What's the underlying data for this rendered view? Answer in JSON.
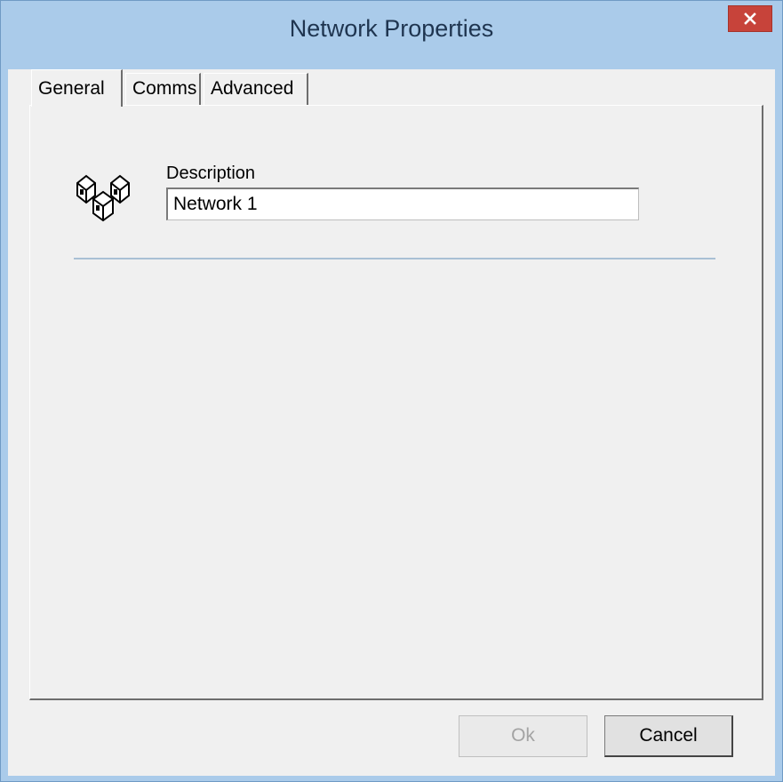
{
  "window": {
    "title": "Network Properties",
    "close_icon": "close-icon"
  },
  "tabs": [
    {
      "label": "General",
      "active": true
    },
    {
      "label": "Comms",
      "active": false
    },
    {
      "label": "Advanced",
      "active": false
    }
  ],
  "general": {
    "icon": "network-nodes-icon",
    "description_label": "Description",
    "description_value": "Network 1"
  },
  "buttons": {
    "ok_label": "Ok",
    "ok_enabled": false,
    "cancel_label": "Cancel"
  },
  "colors": {
    "titlebar": "#aacbea",
    "close_button": "#c7433a",
    "dialog_bg": "#f0f0f0"
  }
}
